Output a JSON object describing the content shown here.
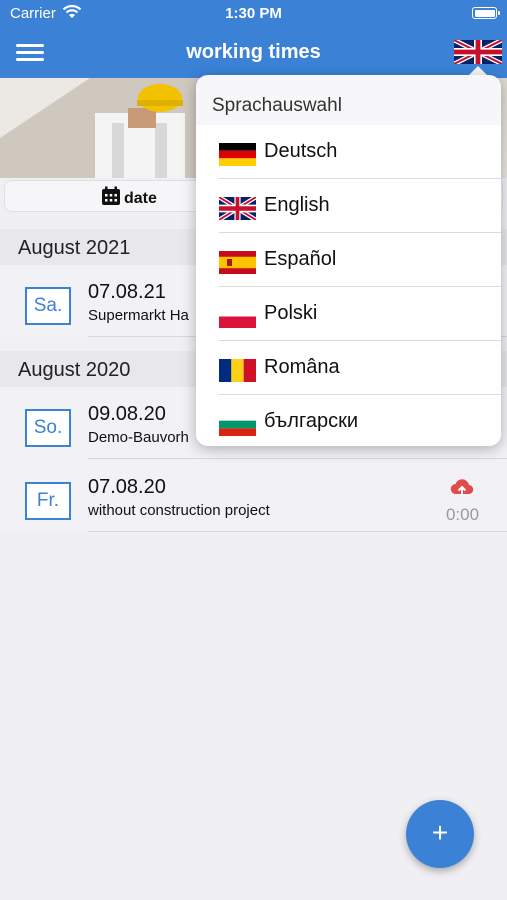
{
  "status": {
    "carrier": "Carrier",
    "time": "1:30 PM"
  },
  "nav": {
    "title": "working times",
    "language_flag": "uk-flag-icon"
  },
  "segment": {
    "date_label": "date",
    "icon": "calendar-icon"
  },
  "sections": [
    {
      "header": "August 2021"
    },
    {
      "header": "August 2020"
    }
  ],
  "entries": [
    {
      "day": "Sa.",
      "date": "07.08.21",
      "project": "Supermarkt Ha"
    },
    {
      "day": "So.",
      "date": "09.08.20",
      "project": "Demo-Bauvorh"
    },
    {
      "day": "Fr.",
      "date": "07.08.20",
      "project": "without construction project",
      "duration": "0:00",
      "upload_icon": "cloud-upload-icon"
    }
  ],
  "language_menu": {
    "title": "Sprachauswahl",
    "languages": [
      {
        "label": "Deutsch",
        "icon": "germany-flag-icon"
      },
      {
        "label": "English",
        "icon": "uk-flag-icon"
      },
      {
        "label": "Español",
        "icon": "spain-flag-icon"
      },
      {
        "label": "Polski",
        "icon": "poland-flag-icon"
      },
      {
        "label": "Româna",
        "icon": "romania-flag-icon"
      },
      {
        "label": "български",
        "icon": "bulgaria-flag-icon"
      }
    ]
  },
  "fab": {
    "label": "+"
  },
  "colors": {
    "primary": "#3b82d6",
    "upload": "#e04b4b"
  }
}
